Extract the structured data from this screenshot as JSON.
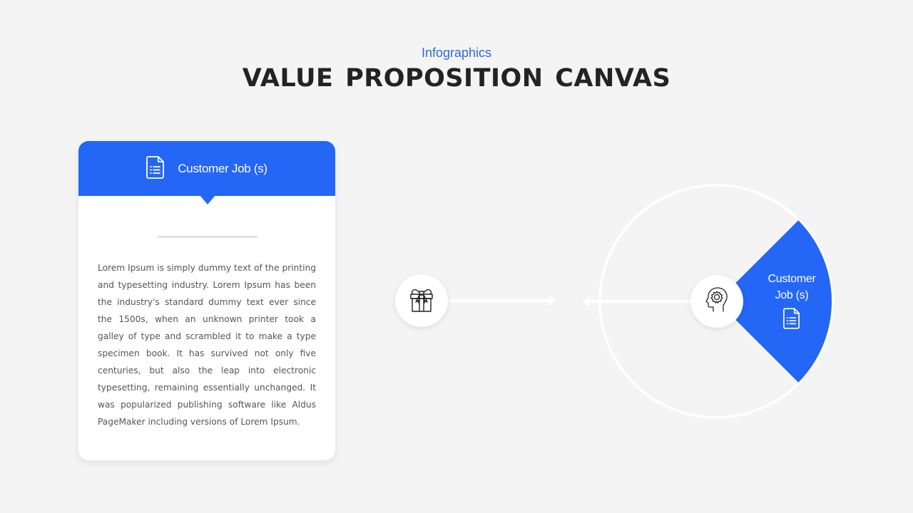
{
  "header": {
    "subtitle": "Infographics",
    "title": "VALUE PROPOSITION  CANVAS"
  },
  "card": {
    "icon": "document-list-icon",
    "title": "Customer Job (s)",
    "body": "Lorem Ipsum is simply dummy text of the printing and typesetting industry. Lorem Ipsum has been the industry's standard dummy text ever since the 1500s, when an unknown printer took a galley of type and scrambled it to make a type specimen book. It has survived not only five centuries, but also the leap into electronic typesetting, remaining essentially unchanged. It was popularized publishing software like Aldus PageMaker including versions of Lorem Ipsum."
  },
  "diagram": {
    "left_node_icon": "gift-icon",
    "right_node_icon": "head-gear-icon",
    "wedge": {
      "label_line1": "Customer",
      "label_line2": "Job (s)",
      "icon": "document-list-icon",
      "start_deg": -45,
      "end_deg": 45
    }
  },
  "colors": {
    "accent": "#2466f5",
    "subtitle": "#2f6ad8",
    "title": "#232323",
    "background": "#f4f4f5",
    "body_text": "#555555"
  }
}
